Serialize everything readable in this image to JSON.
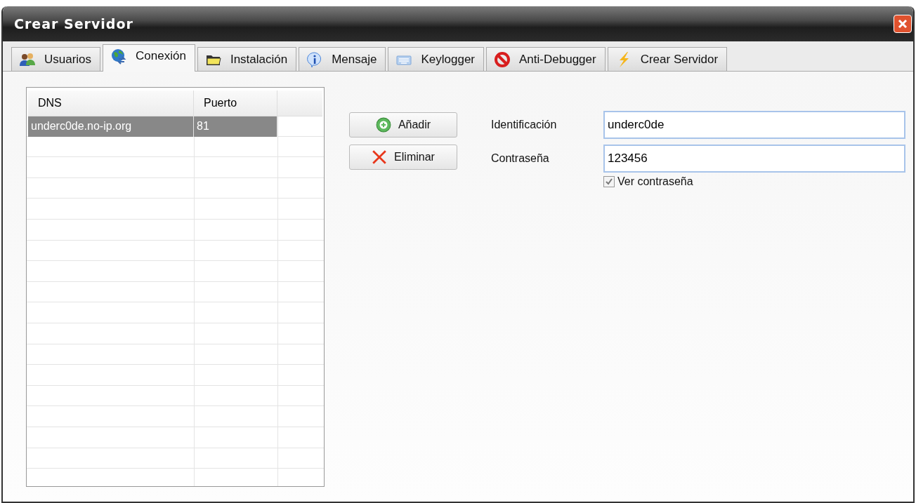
{
  "window": {
    "title": "Crear Servidor"
  },
  "tabs": [
    {
      "label": "Usuarios",
      "selected": false
    },
    {
      "label": "Conexión",
      "selected": true
    },
    {
      "label": "Instalación",
      "selected": false
    },
    {
      "label": "Mensaje",
      "selected": false
    },
    {
      "label": "Keylogger",
      "selected": false
    },
    {
      "label": "Anti-Debugger",
      "selected": false
    },
    {
      "label": "Crear Servidor",
      "selected": false
    }
  ],
  "table": {
    "columns": [
      "DNS",
      "Puerto"
    ],
    "rows": [
      {
        "cells": [
          "underc0de.no-ip.org",
          "81"
        ],
        "selected": true
      }
    ]
  },
  "buttons": [
    {
      "label": "Añadir",
      "kind": "add"
    },
    {
      "label": "Eliminar",
      "kind": "remove"
    }
  ],
  "fields": [
    {
      "label": "Identificación",
      "value": "underc0de"
    },
    {
      "label": "Contraseña",
      "value": "123456"
    }
  ],
  "show_password": {
    "label": "Ver contraseña",
    "checked": true
  }
}
